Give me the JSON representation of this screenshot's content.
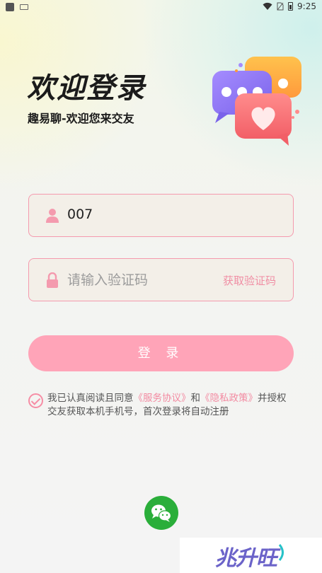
{
  "status_bar": {
    "time": "9:25"
  },
  "header": {
    "title": "欢迎登录",
    "subtitle": "趣易聊-欢迎您来交友"
  },
  "form": {
    "phone": {
      "value": "007",
      "icon": "user-icon"
    },
    "code": {
      "placeholder": "请输入验证码",
      "icon": "lock-icon",
      "action_label": "获取验证码"
    },
    "login_label": "登 录"
  },
  "agreement": {
    "checked": true,
    "prefix": "我已认真阅读且同意",
    "service_link": "《服务协议》",
    "and": "和",
    "privacy_link": "《隐私政策》",
    "suffix": "并授权交友获取本机手机号，首次登录将自动注册"
  },
  "social_login": {
    "icon": "wechat-icon"
  },
  "watermark": {
    "text": "兆升旺"
  },
  "colors": {
    "accent": "#ffa4b8",
    "link": "#f38aa1",
    "wechat": "#2aae3a"
  }
}
